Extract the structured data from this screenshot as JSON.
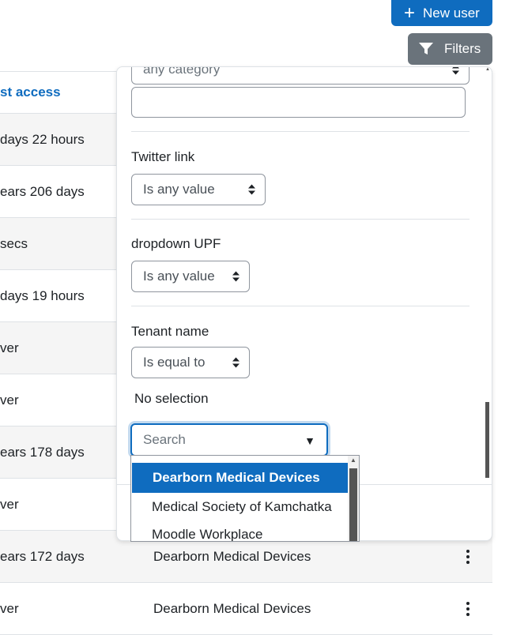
{
  "toolbar": {
    "new_user_label": "New user",
    "filters_label": "Filters",
    "new_user_icon": "plus-icon",
    "filters_icon": "filter-icon",
    "accent": "#0f6cbf",
    "secondary": "#6a737b"
  },
  "table": {
    "header": "st access",
    "rows": [
      {
        "c1": "days 22 hours",
        "c2": ""
      },
      {
        "c1": "ears 206 days",
        "c2": ""
      },
      {
        "c1": "secs",
        "c2": ""
      },
      {
        "c1": "days 19 hours",
        "c2": ""
      },
      {
        "c1": "ver",
        "c2": ""
      },
      {
        "c1": "ver",
        "c2": ""
      },
      {
        "c1": "ears 178 days",
        "c2": ""
      },
      {
        "c1": "ver",
        "c2": ""
      },
      {
        "c1": "ears 172 days",
        "c2": "Dearborn Medical Devices"
      },
      {
        "c1": "ver",
        "c2": "Dearborn Medical Devices"
      }
    ]
  },
  "filters": {
    "category_select": "any category",
    "category_text": "",
    "twitter_label": "Twitter link",
    "twitter_operator": "Is any value",
    "dropdown_label": "dropdown UPF",
    "dropdown_operator": "Is any value",
    "tenant_label": "Tenant name",
    "tenant_operator": "Is equal to",
    "no_selection": "No selection",
    "search_placeholder": "Search",
    "options": [
      "Dearborn Medical Devices",
      "Medical Society of Kamchatka",
      "Moodle Workplace"
    ],
    "selected_option": "Dearborn Medical Devices"
  }
}
